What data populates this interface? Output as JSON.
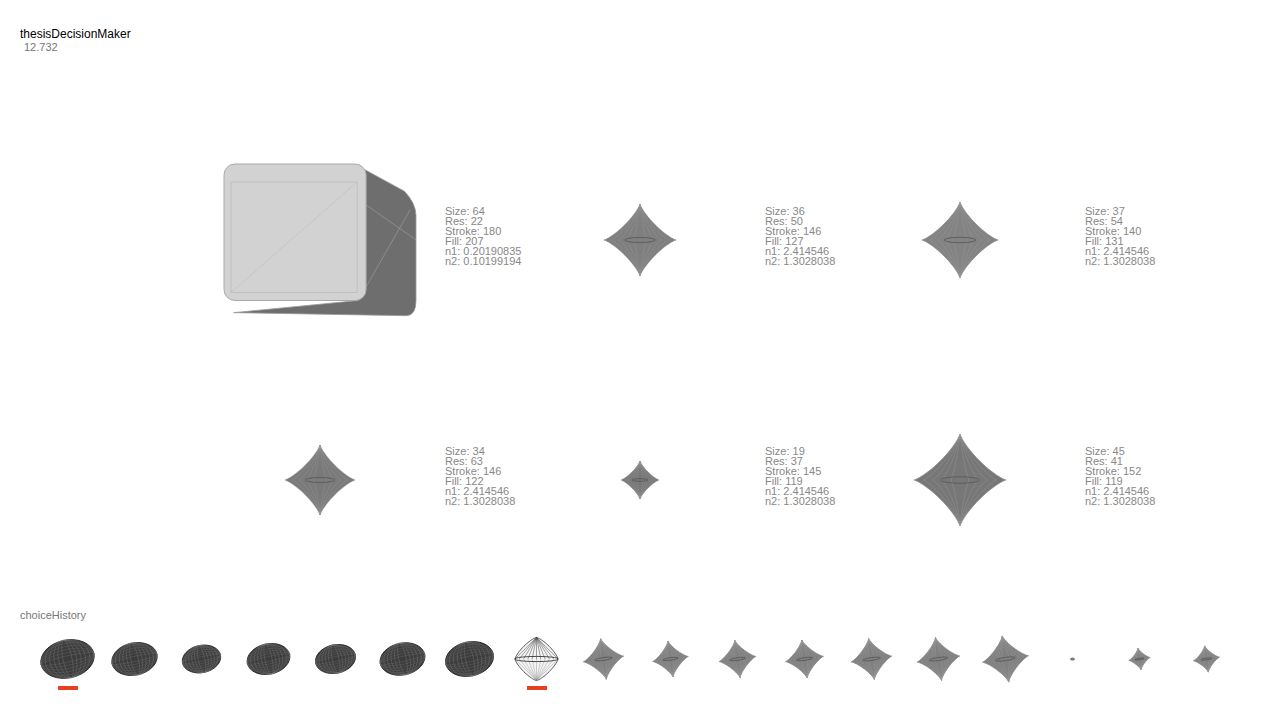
{
  "app": {
    "title": "thesisDecisionMaker",
    "value": "12.732"
  },
  "candidates": [
    {
      "kind": "cube",
      "level": 0.64,
      "color": "#d2d2d2",
      "lines": [
        "Size: 64",
        "Res: 22",
        "Stroke: 180",
        "Fill: 207",
        "n1: 0.20190835",
        "n2: 0.10199194"
      ]
    },
    {
      "kind": "astroid",
      "level": 0.36,
      "color": "#7f7f7f",
      "lines": [
        "Size: 36",
        "Res: 50",
        "Stroke: 146",
        "Fill: 127",
        "n1: 2.414546",
        "n2: 1.3028038"
      ]
    },
    {
      "kind": "astroid",
      "level": 0.38,
      "color": "#838383",
      "lines": [
        "Size: 37",
        "Res: 54",
        "Stroke: 140",
        "Fill: 131",
        "n1: 2.414546",
        "n2: 1.3028038"
      ]
    },
    {
      "kind": "astroid",
      "level": 0.35,
      "color": "#7a7a7a",
      "lines": [
        "Size: 34",
        "Res: 63",
        "Stroke: 146",
        "Fill: 122",
        "n1: 2.414546",
        "n2: 1.3028038"
      ]
    },
    {
      "kind": "astroid",
      "level": 0.19,
      "color": "#777777",
      "lines": [
        "Size: 19",
        "Res: 37",
        "Stroke: 145",
        "Fill: 119",
        "n1: 2.414546",
        "n2: 1.3028038"
      ]
    },
    {
      "kind": "astroid",
      "level": 0.46,
      "color": "#777777",
      "lines": [
        "Size: 45",
        "Res: 41",
        "Stroke: 152",
        "Fill: 119",
        "n1: 2.414546",
        "n2: 1.3028038"
      ]
    }
  ],
  "history": {
    "title": "choiceHistory",
    "items": [
      {
        "kind": "ellipsoid",
        "level": 1.0,
        "selected": true
      },
      {
        "kind": "ellipsoid",
        "level": 0.85,
        "selected": false
      },
      {
        "kind": "ellipsoid",
        "level": 0.72,
        "selected": false
      },
      {
        "kind": "ellipsoid",
        "level": 0.8,
        "selected": false
      },
      {
        "kind": "ellipsoid",
        "level": 0.75,
        "selected": false
      },
      {
        "kind": "ellipsoid",
        "level": 0.84,
        "selected": false
      },
      {
        "kind": "ellipsoid",
        "level": 0.9,
        "selected": false
      },
      {
        "kind": "spindle",
        "level": 0.9,
        "selected": true
      },
      {
        "kind": "astroid",
        "level": 0.85,
        "selected": false
      },
      {
        "kind": "astroid",
        "level": 0.75,
        "selected": false
      },
      {
        "kind": "astroid",
        "level": 0.78,
        "selected": false
      },
      {
        "kind": "astroid",
        "level": 0.8,
        "selected": false
      },
      {
        "kind": "astroid",
        "level": 0.86,
        "selected": false
      },
      {
        "kind": "astroid",
        "level": 0.9,
        "selected": false
      },
      {
        "kind": "astroid",
        "level": 0.97,
        "selected": false
      },
      {
        "kind": "dot",
        "level": 0.08,
        "selected": false
      },
      {
        "kind": "astroid",
        "level": 0.45,
        "selected": false
      },
      {
        "kind": "astroid",
        "level": 0.55,
        "selected": false
      }
    ]
  }
}
